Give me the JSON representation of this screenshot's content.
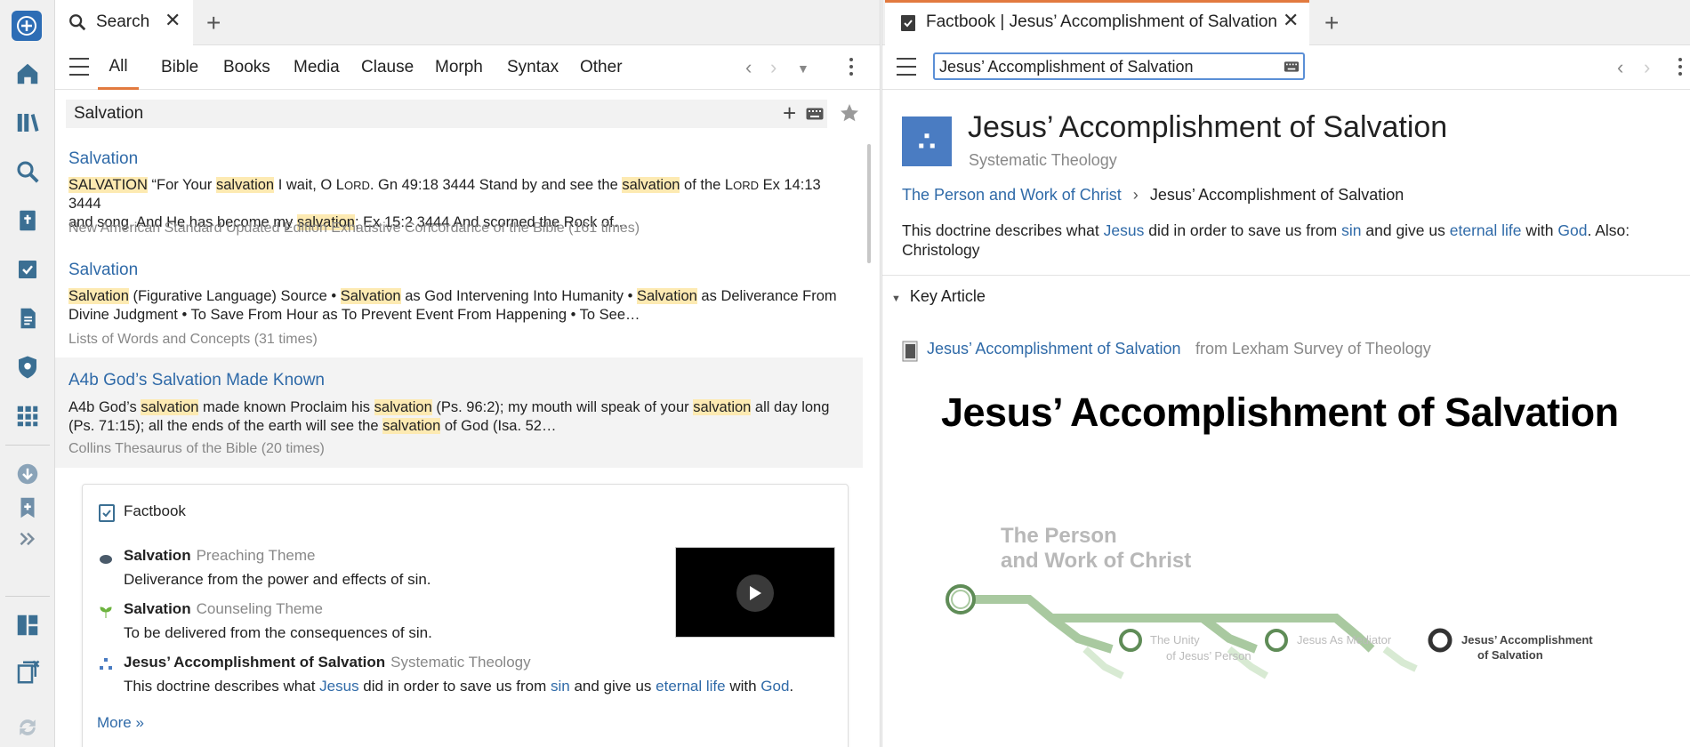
{
  "left_tab": {
    "label": "Search",
    "icon": "search-icon"
  },
  "left_filters": [
    "All",
    "Bible",
    "Books",
    "Media",
    "Clause",
    "Morph",
    "Syntax",
    "Other"
  ],
  "search": {
    "query": "Salvation"
  },
  "results": [
    {
      "title": "Salvation",
      "line1_parts": [
        "SALVATION",
        " “For Your ",
        "salvation",
        " I wait, O L",
        "ORD",
        ". Gn 49:18 3444 Stand by and see the ",
        "salvation",
        " of the L",
        "ORD",
        " Ex 14:13 3444"
      ],
      "line2_parts": [
        "and song, And He has become my ",
        "salvation",
        "; Ex 15:2 3444 And scorned the Rock of…"
      ],
      "source": "New American Standard Updated Edition Exhaustive Concordance of the Bible (161 times)"
    },
    {
      "title": "Salvation",
      "line1_parts": [
        "Salvation",
        " (Figurative Language) Source • ",
        "Salvation",
        " as God Intervening Into Humanity • ",
        "Salvation",
        " as Deliverance From"
      ],
      "line2": "Divine Judgment • To Save From Hour as To Prevent Event From Happening • To See…",
      "source": "Lists of Words and Concepts (31 times)"
    },
    {
      "title": "A4b God’s Salvation Made Known",
      "line1_parts": [
        "A4b God’s ",
        "salvation",
        " made known Proclaim his ",
        "salvation",
        " (Ps. 96:2); my mouth will speak of your ",
        "salvation",
        " all day long"
      ],
      "line2_parts": [
        "(Ps. 71:15); all the ends of the earth will see the ",
        "salvation",
        " of God (Isa. 52…"
      ],
      "source": "Collins Thesaurus of the Bible (20 times)"
    }
  ],
  "factbook_card": {
    "title": "Factbook",
    "items": [
      {
        "title": "Salvation",
        "type": "Preaching Theme",
        "desc": "Deliverance from the power and effects of sin."
      },
      {
        "title": "Salvation",
        "type": "Counseling Theme",
        "desc": "To be delivered from the consequences of sin."
      },
      {
        "title": "Jesus’ Accomplishment of Salvation",
        "type": "Systematic Theology",
        "desc_parts": [
          "This doctrine describes what ",
          "Jesus",
          " did in order to save us from ",
          "sin",
          " and give us ",
          "eternal life",
          " with ",
          "God",
          "."
        ]
      }
    ],
    "more": "More »"
  },
  "right_tab": {
    "label": "Factbook | Jesus’ Accomplishment of Salvation"
  },
  "right": {
    "address": "Jesus’ Accomplishment of Salvation",
    "title": "Jesus’ Accomplishment of Salvation",
    "subtitle": "Systematic Theology",
    "breadcrumb_parent": "The Person and Work of Christ",
    "breadcrumb_sep": "›",
    "breadcrumb_current": "Jesus’ Accomplishment of Salvation",
    "desc_parts": [
      "This doctrine describes what ",
      "Jesus",
      " did in order to save us from ",
      "sin",
      " and give us ",
      "eternal life",
      " with ",
      "God",
      ". Also:"
    ],
    "desc_line2": "Christology",
    "section": "Key Article",
    "article_link": "Jesus’ Accomplishment of Salvation",
    "article_from": "from Lexham Survey of Theology",
    "poster_title": "Jesus’ Accomplishment of Salvation",
    "map_heading_1": "The Person",
    "map_heading_2": "and Work of Christ",
    "stop1_l1": "The Unity",
    "stop1_l2": "of Jesus’ Person",
    "stop2": "Jesus As Mediator",
    "stop3_l1": "Jesus’ Accomplishment",
    "stop3_l2": "of Salvation"
  },
  "colors": {
    "accent": "#e27a3f",
    "link": "#2f6aa8",
    "highlight": "#fdeab2",
    "brand": "#4a7cc2"
  }
}
